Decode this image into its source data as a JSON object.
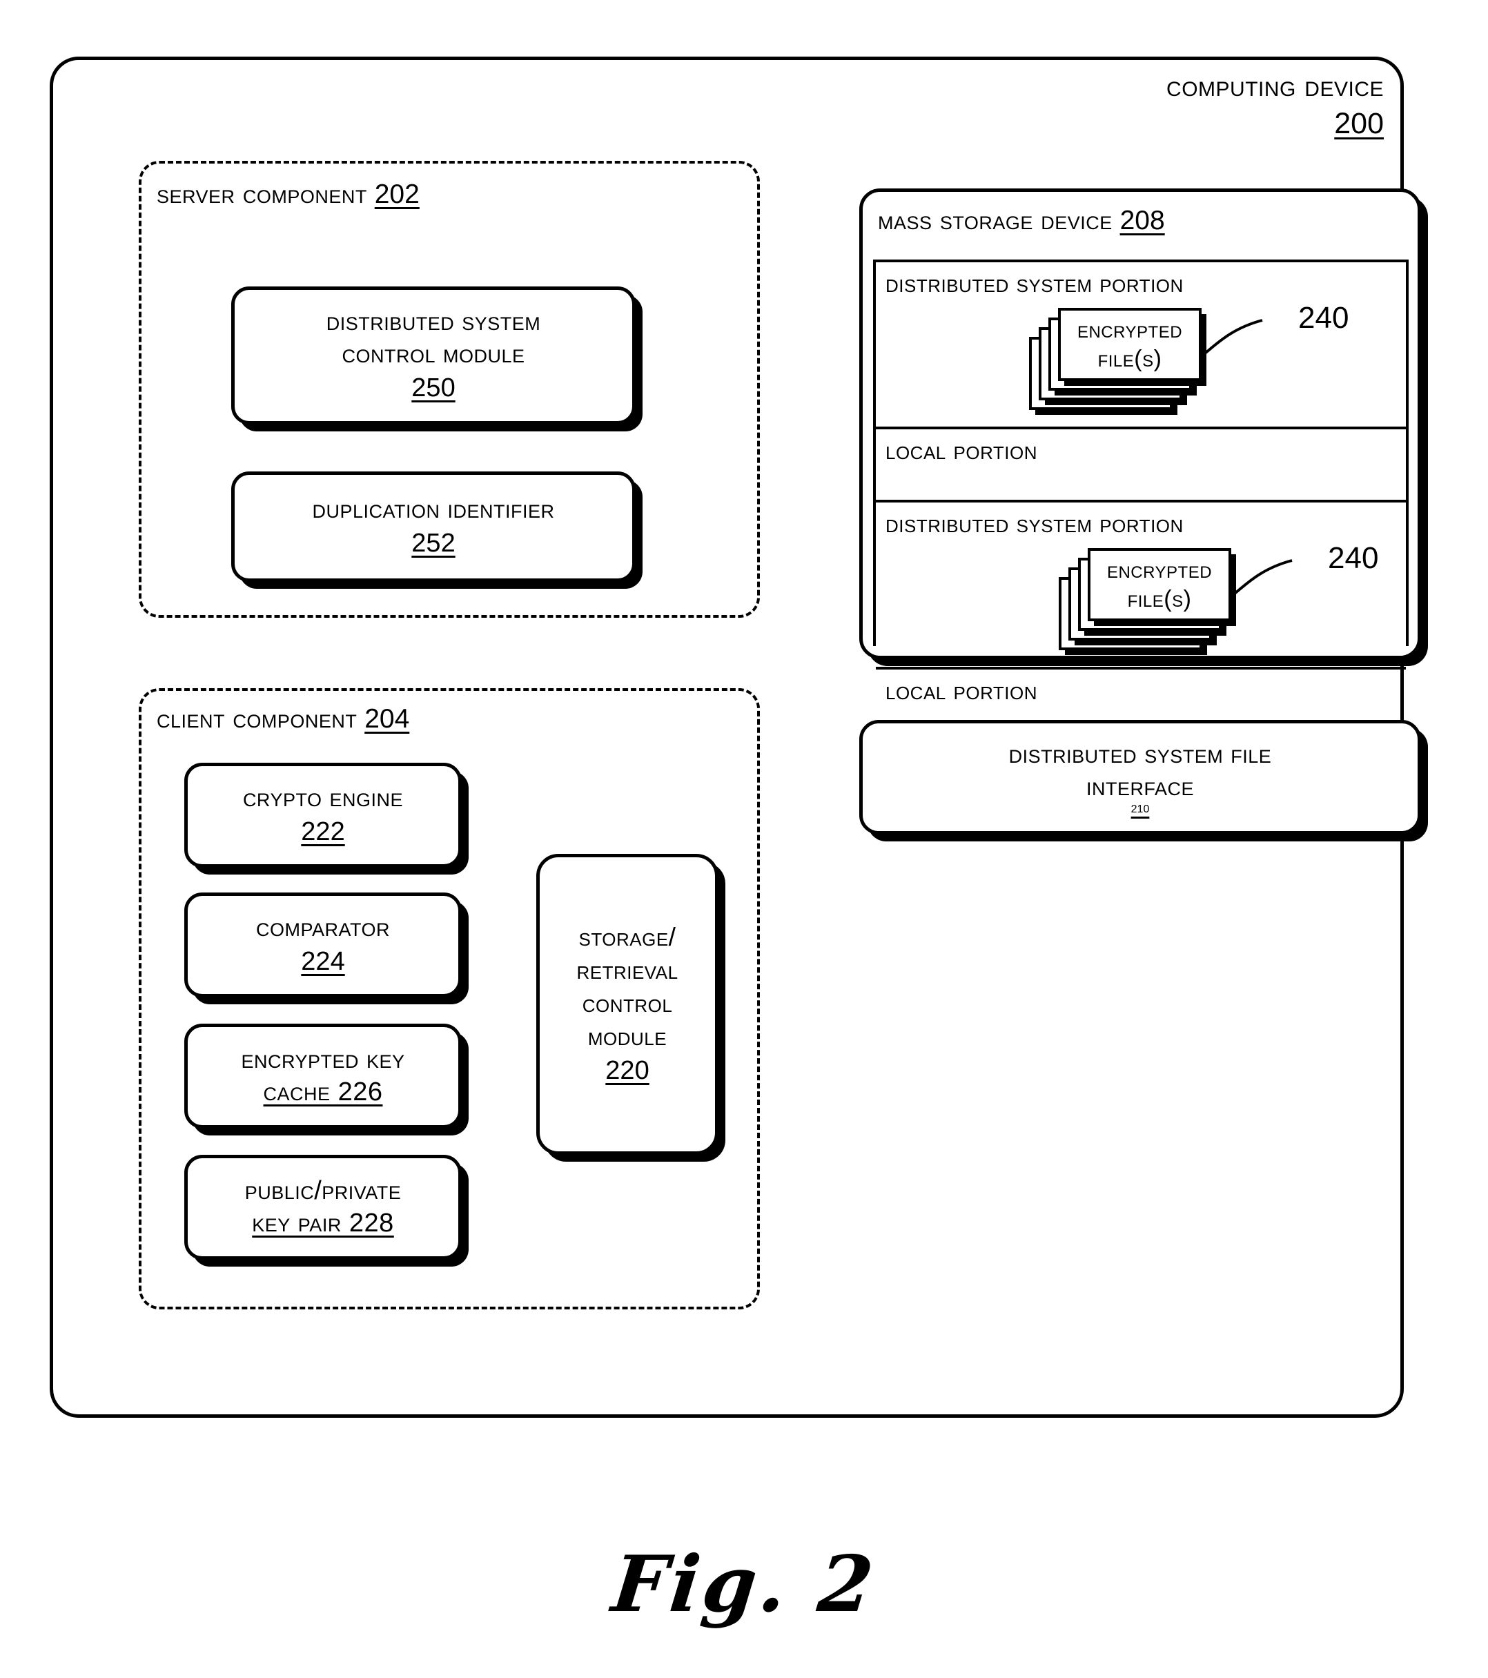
{
  "figure": {
    "caption": "Fig. 2"
  },
  "computing_device": {
    "title": "Computing Device",
    "ref": "200"
  },
  "server_component": {
    "title": "Server Component",
    "ref": "202",
    "modules": [
      {
        "line1": "Distributed System",
        "line2": "Control Module",
        "ref": "250"
      },
      {
        "line1": "Duplication Identifier",
        "ref": "252"
      }
    ]
  },
  "client_component": {
    "title": "Client Component",
    "ref": "204",
    "modules": [
      {
        "line1": "Crypto Engine",
        "ref": "222"
      },
      {
        "line1": "Comparator",
        "ref": "224"
      },
      {
        "line1": "Encrypted Key",
        "line2": "Cache 226"
      },
      {
        "line1": "Public/Private",
        "line2": "Key Pair 228"
      }
    ],
    "storage_retrieval": {
      "line1": "Storage/",
      "line2": "Retrieval",
      "line3": "Control",
      "line4": "Module",
      "ref": "220"
    }
  },
  "mass_storage_device": {
    "title": "Mass Storage Device",
    "ref": "208",
    "rows": [
      {
        "label": "Distributed System Portion",
        "has_files": true
      },
      {
        "label": "Local Portion",
        "has_files": false
      },
      {
        "label": "Distributed System Portion",
        "has_files": true
      },
      {
        "label": "Local Portion",
        "has_files": false
      }
    ],
    "encrypted_files": {
      "line1": "Encrypted",
      "line2": "File(s)",
      "ref": "240"
    }
  },
  "dist_sys_file_interface": {
    "line1": "Distributed System File",
    "line2": "Interface",
    "ref": "210"
  }
}
